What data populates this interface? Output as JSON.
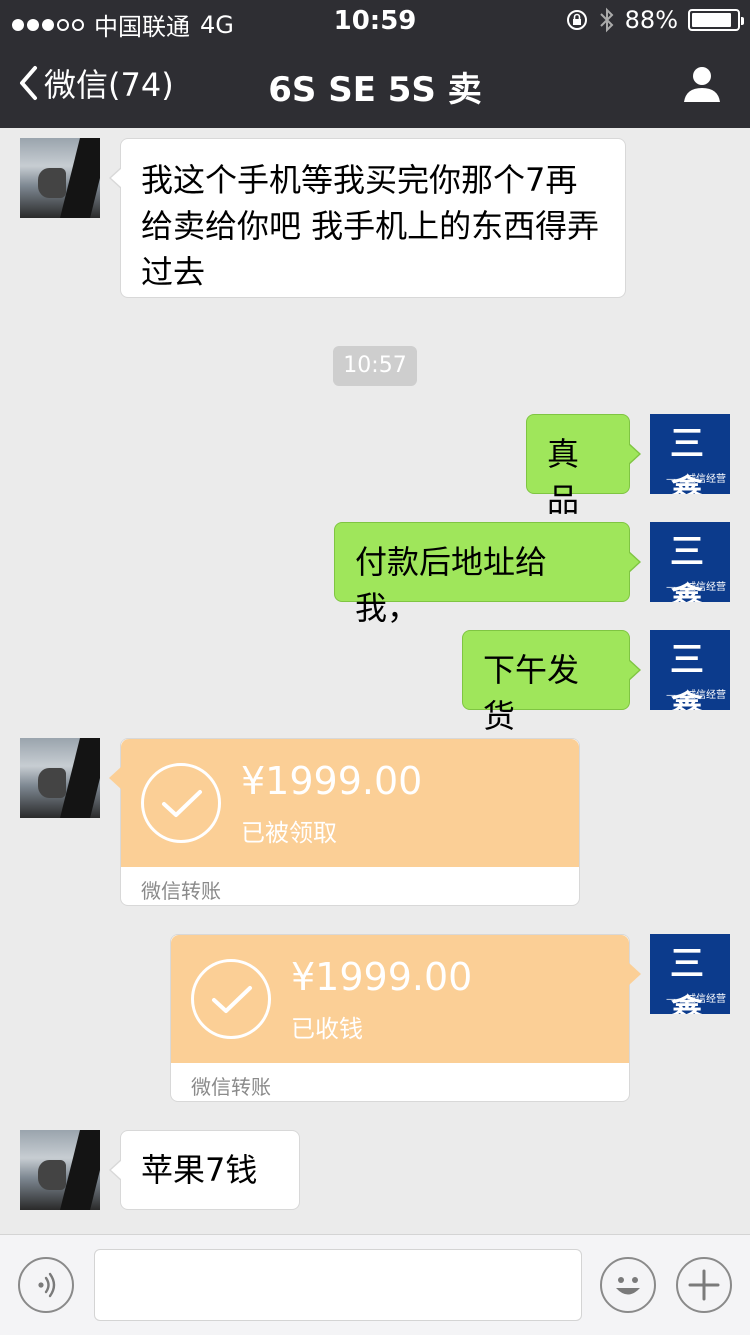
{
  "status_bar": {
    "carrier": "中国联通",
    "network": "4G",
    "time": "10:59",
    "battery": "88%",
    "battery_level": 0.88
  },
  "nav": {
    "back_label": "微信(74)",
    "title": "6S SE 5S 卖"
  },
  "messages": {
    "m1": {
      "text": "我这个手机等我买完你那个7再给卖给你吧  我手机上的东西得弄过去"
    },
    "timestamp": "10:57",
    "m2": {
      "text": "真品"
    },
    "m3": {
      "text": "付款后地址给我，"
    },
    "m4": {
      "text": "下午发货"
    },
    "t1": {
      "amount": "¥1999.00",
      "status": "已被领取",
      "footer": "微信转账"
    },
    "t2": {
      "amount": "¥1999.00",
      "status": "已收钱",
      "footer": "微信转账"
    },
    "m5": {
      "text": "苹果7钱"
    }
  },
  "brand_avatar": {
    "big": "三 鑫",
    "small": "——诚信经营"
  },
  "input": {
    "value": "",
    "placeholder": ""
  },
  "colors": {
    "header_bg": "#2e2e33",
    "chat_bg": "#ebebeb",
    "outgoing_bubble": "#9fe65b",
    "transfer_orange": "#fbcf96",
    "brand_blue": "#0c3b8c"
  }
}
